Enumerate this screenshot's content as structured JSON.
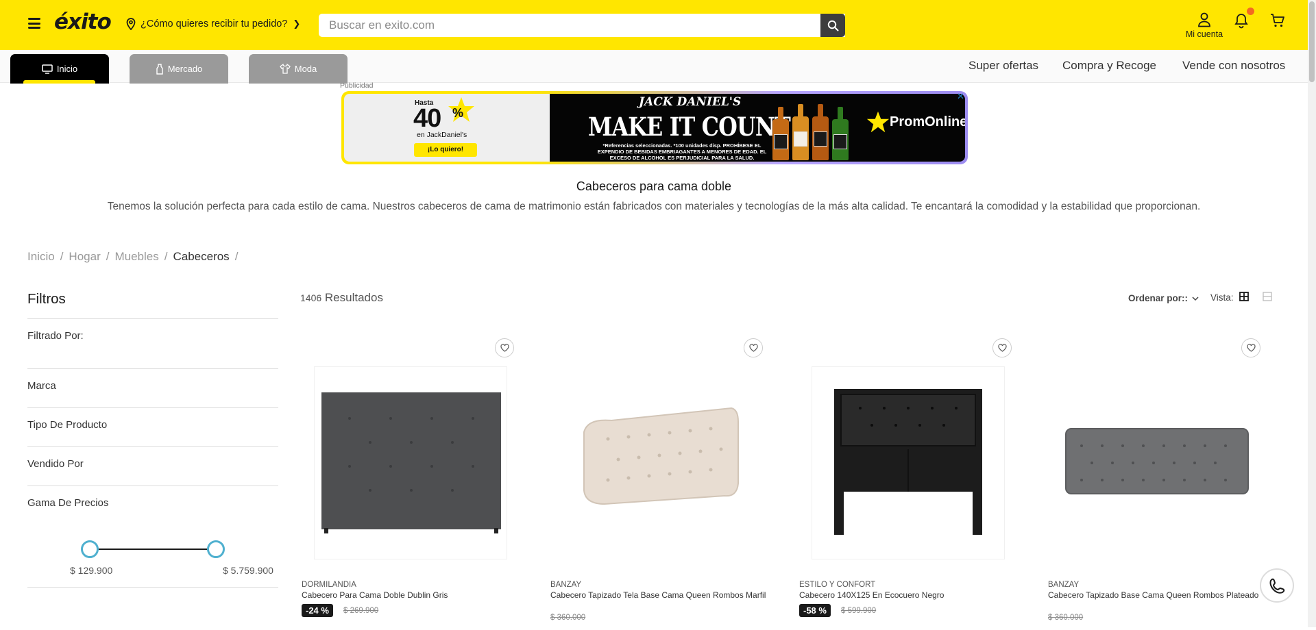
{
  "header": {
    "logo": "éxito",
    "delivery_prompt": "¿Cómo quieres recibir tu pedido?",
    "search_placeholder": "Buscar en exito.com",
    "account_label": "Mi cuenta"
  },
  "colors": {
    "brand_yellow": "#ffe600",
    "dark": "#1a1a1a",
    "accent_knob": "#4fb0cf",
    "notification": "#f36a21"
  },
  "category_tabs": [
    {
      "label": "Inicio",
      "icon": "monitor-icon",
      "active": true
    },
    {
      "label": "Mercado",
      "icon": "bottle-icon",
      "active": false
    },
    {
      "label": "Moda",
      "icon": "shirt-icon",
      "active": false
    }
  ],
  "nav_links": [
    "Super ofertas",
    "Compra y Recoge",
    "Vende con nosotros"
  ],
  "ad": {
    "label": "Publicidad",
    "hasta": "Hasta",
    "percent": "40",
    "percent_sign": "%",
    "brand_line": "en JackDaniel's",
    "cta": "¡Lo quiero!",
    "brand": "JACK DANIEL'S",
    "headline": "MAKE IT COUNT",
    "fine_print": "*Referencias seleccionadas. *100 unidades disp. PROHÍBESE EL EXPENDIO DE BEBIDAS EMBRIAGANTES A MENORES DE EDAD. EL EXCESO DE ALCOHOL ES PERJUDICIAL PARA LA SALUD.",
    "promo": "PromOnline",
    "close": "✕"
  },
  "category": {
    "title": "Cabeceros para cama doble",
    "description": "Tenemos la solución perfecta para cada estilo de cama. Nuestros cabeceros de cama de matrimonio están fabricados con materiales y tecnologías de la más alta calidad. Te encantará la comodidad y la estabilidad que proporcionan."
  },
  "breadcrumb": [
    "Inicio",
    "Hogar",
    "Muebles",
    "Cabeceros"
  ],
  "filters": {
    "title": "Filtros",
    "filtered_by": "Filtrado Por:",
    "items": [
      "Marca",
      "Tipo De Producto",
      "Vendido Por",
      "Gama De Precios"
    ],
    "price_min": "$ 129.900",
    "price_max": "$ 5.759.900"
  },
  "results": {
    "count": "1406",
    "label": "Resultados"
  },
  "sort_label": "Ordenar por::",
  "view_label": "Vista:",
  "products": [
    {
      "brand": "DORMILANDIA",
      "name": "Cabecero Para Cama Doble Dublin Gris",
      "discount": "-24 %",
      "old_price": "$ 269.900",
      "image": "gray-tufted-headboard"
    },
    {
      "brand": "BANZAY",
      "name": "Cabecero Tapizado Tela Base Cama Queen Rombos Marfil",
      "discount": "",
      "old_price": "$ 360.000",
      "image": "ivory-tufted-headboard"
    },
    {
      "brand": "ESTILO Y CONFORT",
      "name": "Cabecero 140X125 En Ecocuero Negro",
      "discount": "-58 %",
      "old_price": "$ 599.900",
      "image": "black-leather-headboard"
    },
    {
      "brand": "BANZAY",
      "name": "Cabecero Tapizado Base Cama Queen Rombos Plateado",
      "discount": "",
      "old_price": "$ 360.000",
      "image": "silver-tufted-headboard"
    }
  ]
}
